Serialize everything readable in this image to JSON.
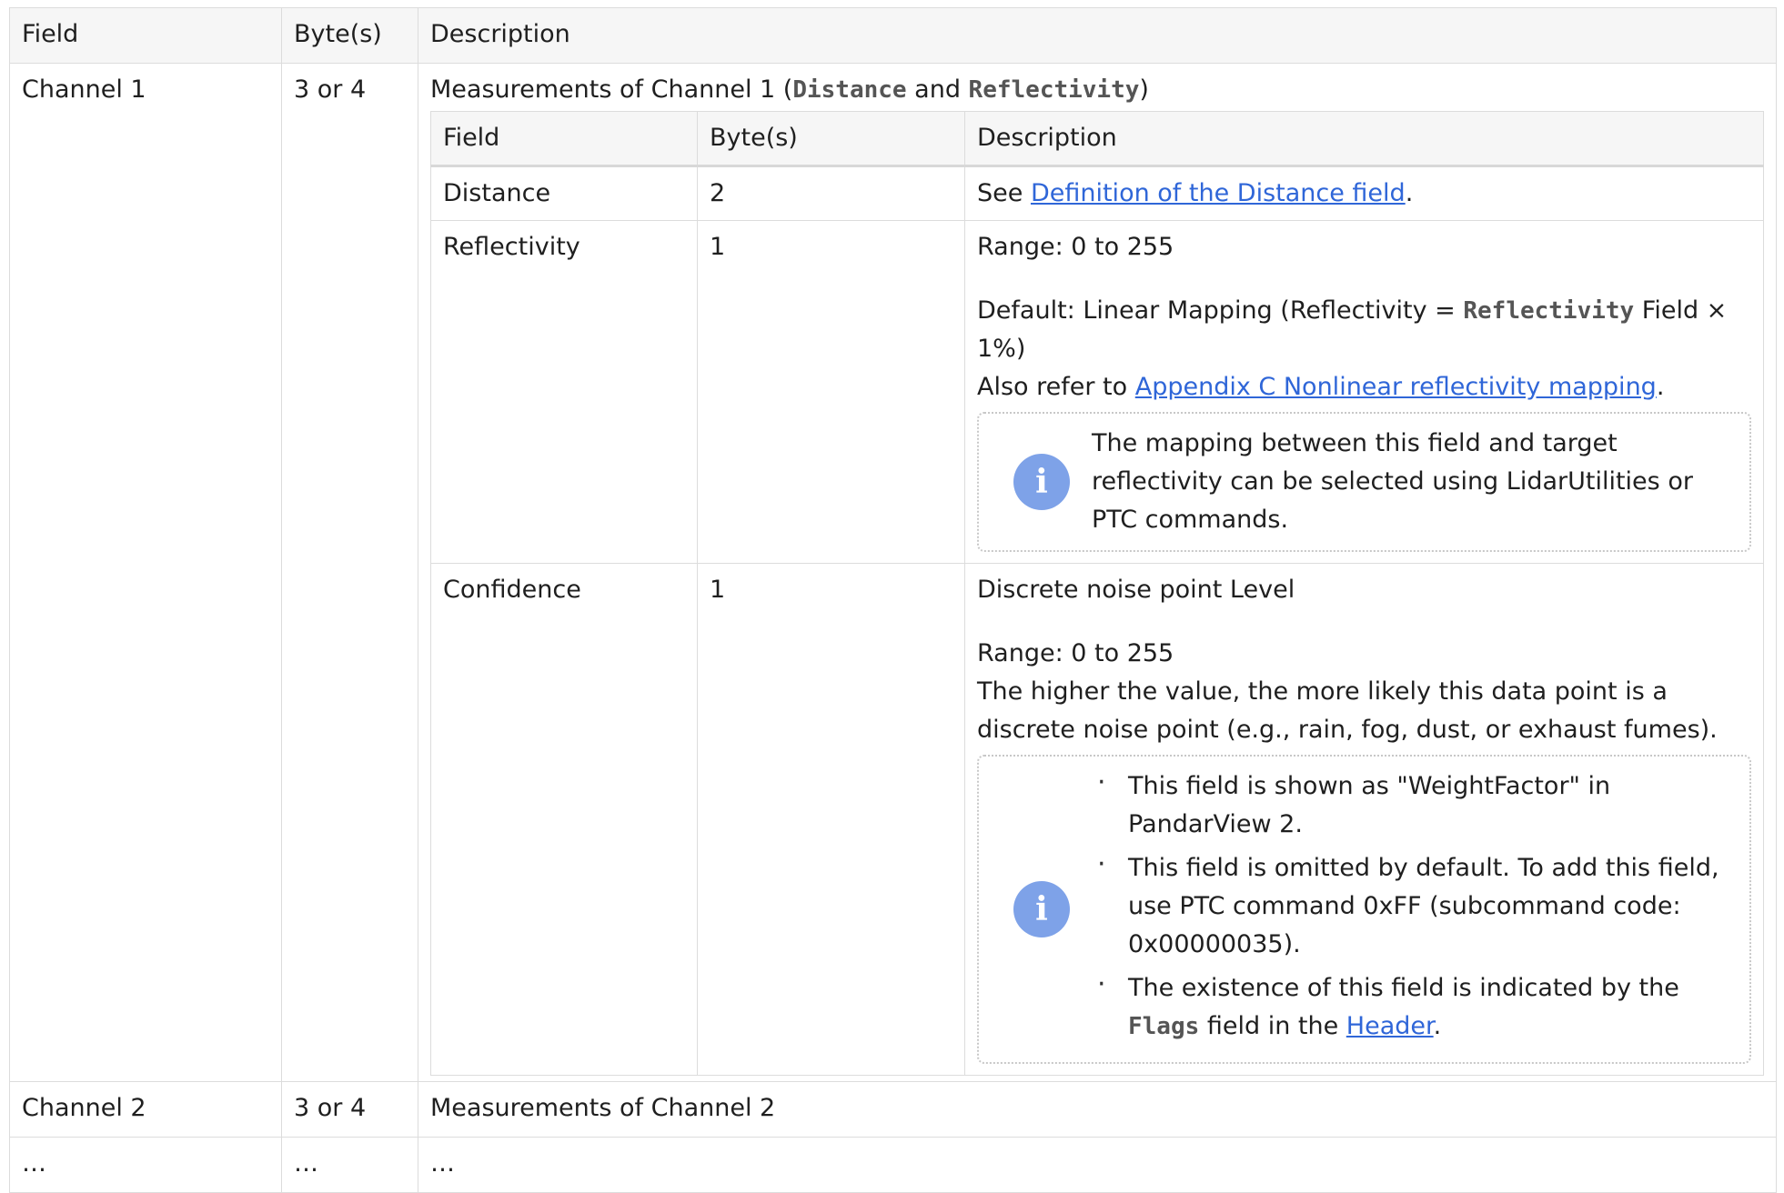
{
  "headers": {
    "field": "Field",
    "bytes": "Byte(s)",
    "description": "Description"
  },
  "rows": {
    "channel1": {
      "field": "Channel 1",
      "bytes": "3 or 4",
      "desc_prefix": "Measurements of Channel 1 (",
      "desc_code1": "Distance",
      "desc_mid": " and ",
      "desc_code2": "Reflectivity",
      "desc_suffix": ")"
    },
    "channel2": {
      "field": "Channel 2",
      "bytes": "3 or 4",
      "description": "Measurements of Channel 2"
    },
    "ellipsis": {
      "field": "…",
      "bytes": "…",
      "description": "…"
    }
  },
  "inner": {
    "headers": {
      "field": "Field",
      "bytes": "Byte(s)",
      "description": "Description"
    },
    "distance": {
      "field": "Distance",
      "bytes": "2",
      "see": "See ",
      "link": "Definition of the Distance field",
      "end": "."
    },
    "reflectivity": {
      "field": "Reflectivity",
      "bytes": "1",
      "range": "Range: 0 to 255",
      "default_prefix": "Default: Linear Mapping (Reflectivity = ",
      "default_code": "Reflectivity",
      "default_suffix": " Field × 1%)",
      "refer_prefix": "Also refer to ",
      "refer_link": "Appendix C Nonlinear reflectivity mapping",
      "refer_end": ".",
      "note": "The mapping between this field and target reflectivity can be selected using LidarUtilities or PTC commands."
    },
    "confidence": {
      "field": "Confidence",
      "bytes": "1",
      "line1": "Discrete noise point Level",
      "range": "Range: 0 to 255",
      "explain": "The higher the value, the more likely this data point is a discrete noise point (e.g., rain, fog, dust, or exhaust fumes).",
      "bullet1": "This field is shown as \"WeightFactor\" in PandarView 2.",
      "bullet2": "This field is omitted by default. To add this field, use PTC command 0xFF (subcommand code: 0x00000035).",
      "bullet3_prefix": "The existence of this field is indicated by the ",
      "bullet3_code": "Flags",
      "bullet3_mid": " field in the ",
      "bullet3_link": "Header",
      "bullet3_end": "."
    }
  },
  "icons": {
    "note_icon": "info-icon"
  },
  "colors": {
    "link": "#2f66d8",
    "icon": "#7ea2e8",
    "header_bg": "#f6f6f6",
    "border": "#dcdcdc"
  }
}
